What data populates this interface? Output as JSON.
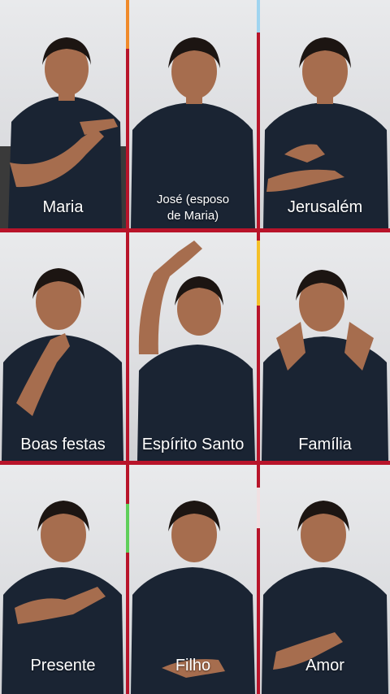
{
  "tiles": [
    {
      "label": "Maria"
    },
    {
      "label": "José (esposo\nde Maria)"
    },
    {
      "label": "Jerusalém"
    },
    {
      "label": "Boas festas"
    },
    {
      "label": "Espírito Santo"
    },
    {
      "label": "Família"
    },
    {
      "label": "Presente"
    },
    {
      "label": "Filho"
    },
    {
      "label": "Amor"
    }
  ],
  "colors": {
    "frame": "#b8142a",
    "shirt": "#1a2433",
    "skin": "#a66d4e",
    "hair": "#1c1512"
  }
}
